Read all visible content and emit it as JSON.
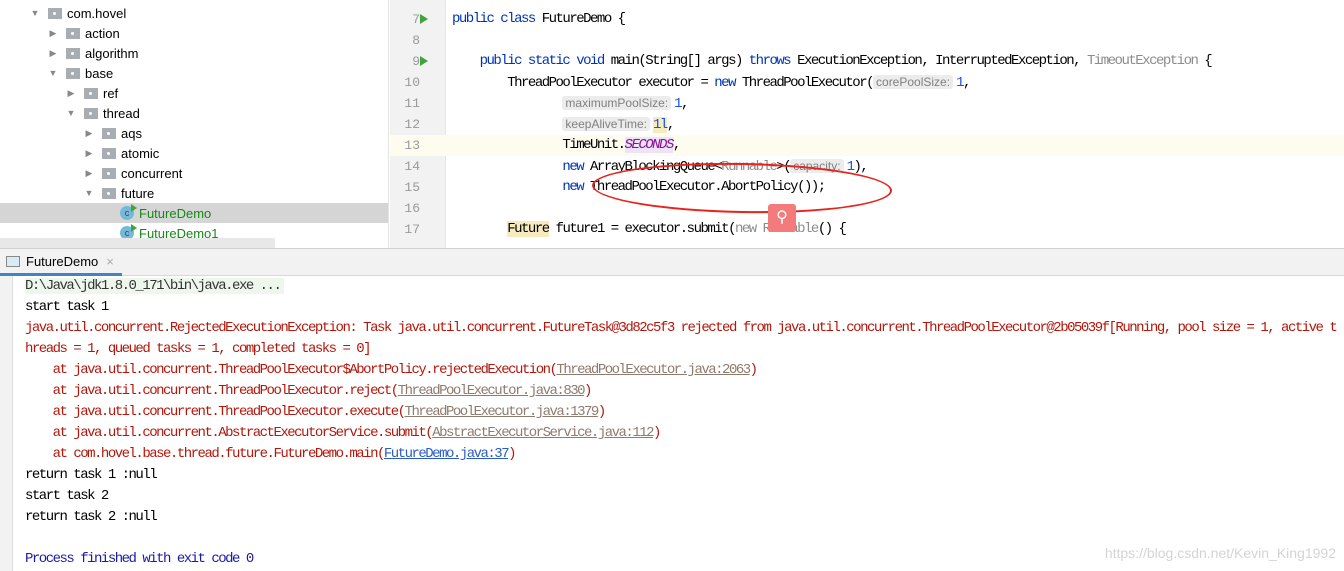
{
  "tree": [
    {
      "label": "com.hovel",
      "level": 0,
      "expanded": true,
      "kind": "folder"
    },
    {
      "label": "action",
      "level": 1,
      "expanded": false,
      "kind": "folder"
    },
    {
      "label": "algorithm",
      "level": 1,
      "expanded": false,
      "kind": "folder"
    },
    {
      "label": "base",
      "level": 1,
      "expanded": true,
      "kind": "folder"
    },
    {
      "label": "ref",
      "level": 2,
      "expanded": false,
      "kind": "folder"
    },
    {
      "label": "thread",
      "level": 2,
      "expanded": true,
      "kind": "folder"
    },
    {
      "label": "aqs",
      "level": 3,
      "expanded": false,
      "kind": "folder"
    },
    {
      "label": "atomic",
      "level": 3,
      "expanded": false,
      "kind": "folder"
    },
    {
      "label": "concurrent",
      "level": 3,
      "expanded": false,
      "kind": "folder"
    },
    {
      "label": "future",
      "level": 3,
      "expanded": true,
      "kind": "folder"
    },
    {
      "label": "FutureDemo",
      "level": 4,
      "kind": "class",
      "selected": true
    },
    {
      "label": "FutureDemo1",
      "level": 4,
      "kind": "class"
    }
  ],
  "editor": {
    "lines": [
      {
        "n": "7",
        "run": true,
        "tokens": [
          [
            "kw",
            "public class "
          ],
          [
            "",
            "FutureDemo {"
          ]
        ]
      },
      {
        "n": "8",
        "tokens": []
      },
      {
        "n": "9",
        "run": true,
        "tokens": [
          [
            "",
            "    "
          ],
          [
            "kw",
            "public static void "
          ],
          [
            "",
            "main(String[] args) "
          ],
          [
            "kw",
            "throws "
          ],
          [
            "",
            "ExecutionException, InterruptedException, "
          ],
          [
            "gray",
            "TimeoutException"
          ],
          [
            "",
            " {"
          ]
        ]
      },
      {
        "n": "10",
        "tokens": [
          [
            "",
            "        ThreadPoolExecutor executor = "
          ],
          [
            "kw",
            "new "
          ],
          [
            "",
            "ThreadPoolExecutor("
          ],
          [
            "hint",
            "corePoolSize:"
          ],
          [
            "num",
            "1"
          ],
          [
            "",
            ","
          ]
        ]
      },
      {
        "n": "11",
        "tokens": [
          [
            "",
            "                "
          ],
          [
            "hint",
            "maximumPoolSize:"
          ],
          [
            "num",
            "1"
          ],
          [
            "",
            ","
          ]
        ]
      },
      {
        "n": "12",
        "tokens": [
          [
            "",
            "                "
          ],
          [
            "hint",
            "keepAliveTime:"
          ],
          [
            "num mark",
            "1l"
          ],
          [
            "",
            ","
          ]
        ]
      },
      {
        "n": "13",
        "highlight": true,
        "tokens": [
          [
            "",
            "                TimeUnit."
          ],
          [
            "field fieldbg",
            "SECONDS"
          ],
          [
            "",
            ","
          ]
        ]
      },
      {
        "n": "14",
        "tokens": [
          [
            "",
            "                "
          ],
          [
            "kw",
            "new "
          ],
          [
            "",
            "ArrayBlockingQueue<"
          ],
          [
            "gray",
            "Runnable"
          ],
          [
            "",
            ">("
          ],
          [
            "hint",
            "capacity:"
          ],
          [
            "num",
            "1"
          ],
          [
            "",
            "),"
          ]
        ]
      },
      {
        "n": "15",
        "tokens": [
          [
            "",
            "                "
          ],
          [
            "kw",
            "new "
          ],
          [
            "",
            "ThreadPoolExecutor.AbortPolicy());"
          ]
        ]
      },
      {
        "n": "16",
        "tokens": []
      },
      {
        "n": "17",
        "tokens": [
          [
            "",
            "        "
          ],
          [
            "mark",
            "Future"
          ],
          [
            "",
            " future1 = executor.submit("
          ],
          [
            "gray",
            "new Runnable"
          ],
          [
            "",
            "() {"
          ]
        ]
      }
    ]
  },
  "console": {
    "tab": "FutureDemo",
    "lines": [
      [
        [
          "cmd",
          "D:\\Java\\jdk1.8.0_171\\bin\\java.exe ..."
        ]
      ],
      [
        [
          "",
          "start task 1"
        ]
      ],
      [
        [
          "err",
          "java.util.concurrent.RejectedExecutionException: Task java.util.concurrent.FutureTask@3d82c5f3 rejected from java.util.concurrent.ThreadPoolExecutor@2b05039f[Running, pool size = 1, active threads = 1, queued tasks = 1, completed tasks = 0]"
        ]
      ],
      [
        [
          "err",
          "    at java.util.concurrent.ThreadPoolExecutor$AbortPolicy.rejectedExecution("
        ],
        [
          "lnk",
          "ThreadPoolExecutor.java:2063"
        ],
        [
          "err",
          ")"
        ]
      ],
      [
        [
          "err",
          "    at java.util.concurrent.ThreadPoolExecutor.reject("
        ],
        [
          "lnk",
          "ThreadPoolExecutor.java:830"
        ],
        [
          "err",
          ")"
        ]
      ],
      [
        [
          "err",
          "    at java.util.concurrent.ThreadPoolExecutor.execute("
        ],
        [
          "lnk",
          "ThreadPoolExecutor.java:1379"
        ],
        [
          "err",
          ")"
        ]
      ],
      [
        [
          "err",
          "    at java.util.concurrent.AbstractExecutorService.submit("
        ],
        [
          "lnk",
          "AbstractExecutorService.java:112"
        ],
        [
          "err",
          ")"
        ]
      ],
      [
        [
          "err",
          "    at com.hovel.base.thread.future.FutureDemo.main("
        ],
        [
          "lnkb",
          "FutureDemo.java:37"
        ],
        [
          "err",
          ")"
        ]
      ],
      [
        [
          "",
          "return task 1 :null"
        ]
      ],
      [
        [
          "",
          "start task 2"
        ]
      ],
      [
        [
          "",
          "return task 2 :null"
        ]
      ],
      [
        [
          "",
          ""
        ]
      ],
      [
        [
          "exit",
          "Process finished with exit code 0"
        ]
      ]
    ]
  },
  "watermark": "https://blog.csdn.net/Kevin_King1992",
  "colors": {
    "annotation": "#e8231b",
    "run": "#3fa33f",
    "error": "#b3170c"
  }
}
